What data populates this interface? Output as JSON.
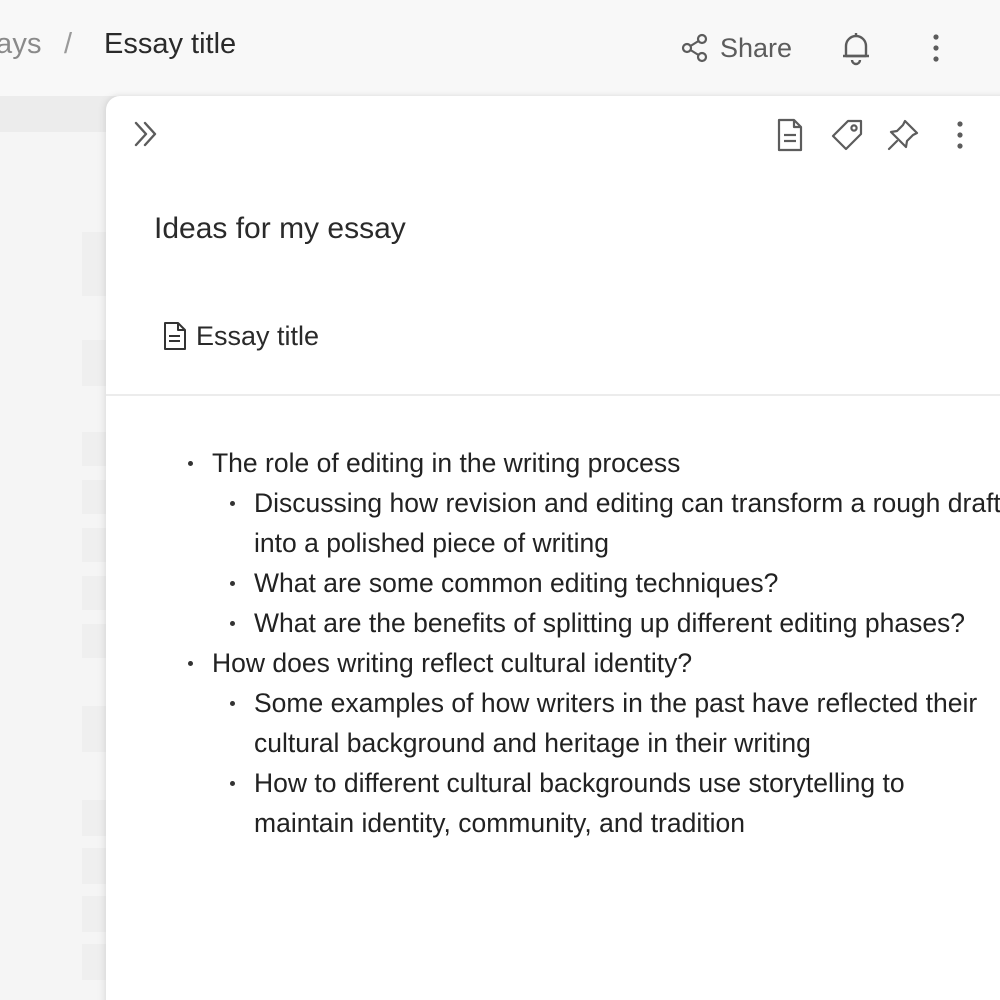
{
  "breadcrumb": {
    "previous": "ays",
    "separator": "/",
    "current": "Essay title"
  },
  "header": {
    "share_label": "Share",
    "icons": [
      "share-icon",
      "bell-icon",
      "more-vertical-icon"
    ]
  },
  "panel": {
    "icons": [
      "collapse-panel-icon",
      "document-icon",
      "tag-icon",
      "pin-icon",
      "more-vertical-icon"
    ],
    "title": "Ideas for my essay",
    "linked_doc": "Essay title",
    "note": {
      "items": [
        {
          "text": "The role of editing in the writing process",
          "children": [
            "Discussing how revision and editing can transform a rough draft into a polished piece of writing",
            "What are some common editing techniques?",
            "What are the benefits of splitting up different editing phases?"
          ]
        },
        {
          "text": "How does writing reflect cultural identity?",
          "children": [
            "Some examples of how writers in the past have reflected their cultural background and heritage in their writing",
            "How to different cultural backgrounds use storytelling to maintain identity, community, and tradition"
          ]
        }
      ]
    }
  },
  "colors": {
    "panel_background": "#ffffff",
    "page_background": "#f7f7f7",
    "icon_gray": "#5c5c5c"
  }
}
